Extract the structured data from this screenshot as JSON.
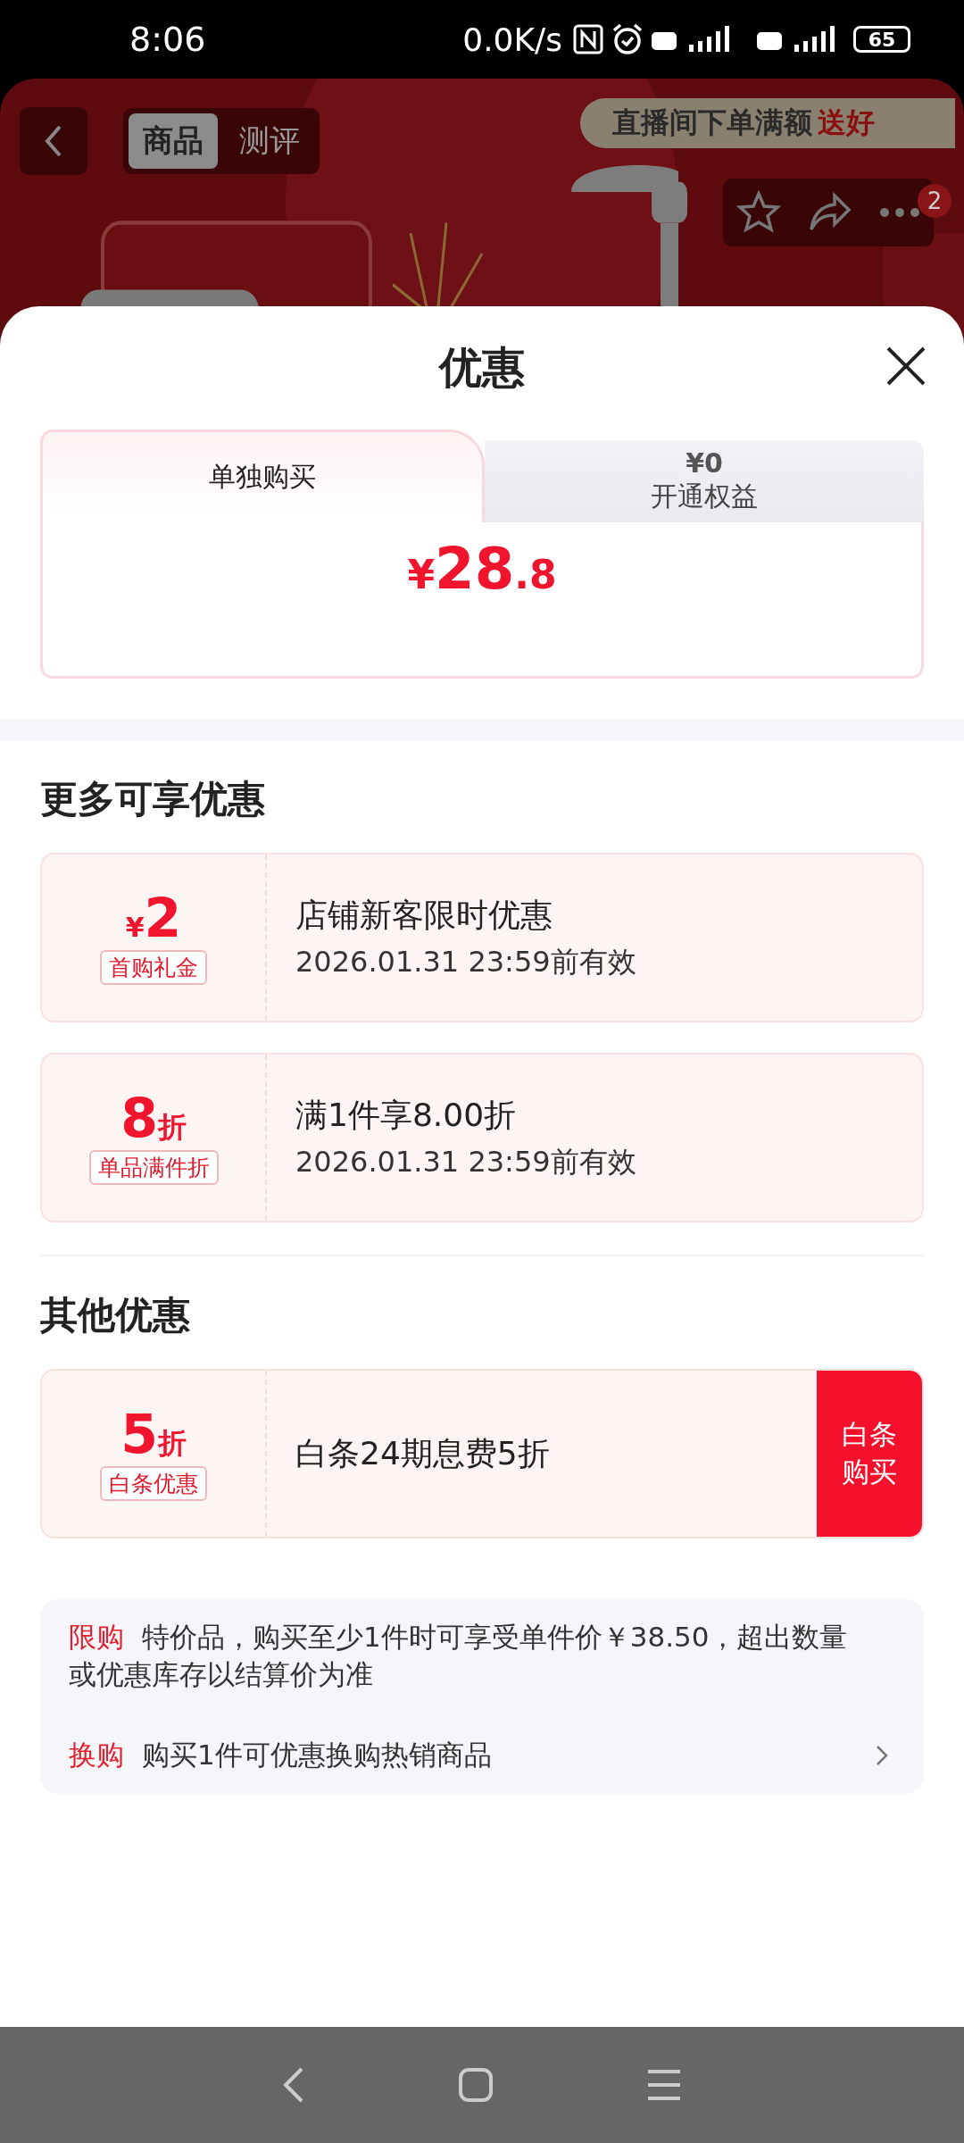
{
  "status_bar": {
    "time": "8:06",
    "net_speed": "0.0K/s",
    "battery": "65"
  },
  "header": {
    "tabs": [
      {
        "label": "商品",
        "selected": true
      },
      {
        "label": "测评",
        "selected": false
      }
    ],
    "live_banner": {
      "text": "直播间下单满额",
      "highlight": "送好"
    },
    "cart_badge": "2"
  },
  "sheet": {
    "title": "优惠",
    "purchase_tabs": [
      {
        "label": "单独购买",
        "selected": true
      },
      {
        "price": "¥0",
        "label": "开通权益",
        "selected": false
      }
    ],
    "price": {
      "currency": "¥",
      "integer": "28",
      "decimal": ".8"
    },
    "sections": [
      {
        "title": "更多可享优惠",
        "coupons": [
          {
            "kind": "cash",
            "prefix": "¥",
            "amount": "2",
            "tag": "首购礼金",
            "title": "店铺新客限时优惠",
            "validity": "2026.01.31 23:59前有效"
          },
          {
            "kind": "discount",
            "amount": "8",
            "suffix": "折",
            "tag": "单品满件折",
            "title": "满1件享8.00折",
            "validity": "2026.01.31 23:59前有效"
          }
        ]
      },
      {
        "title": "其他优惠",
        "coupons": [
          {
            "kind": "discount",
            "amount": "5",
            "suffix": "折",
            "tag": "白条优惠",
            "title": "白条24期息费5折",
            "action": [
              "白条",
              "购买"
            ]
          }
        ]
      }
    ],
    "notes": [
      {
        "label": "限购",
        "text": "特价品，购买至少1件时可享受单件价￥38.50，超出数量或优惠库存以结算价为准",
        "has_arrow": false
      },
      {
        "label": "换购",
        "text": "购买1件可优惠换购热销商品",
        "has_arrow": true
      }
    ]
  }
}
